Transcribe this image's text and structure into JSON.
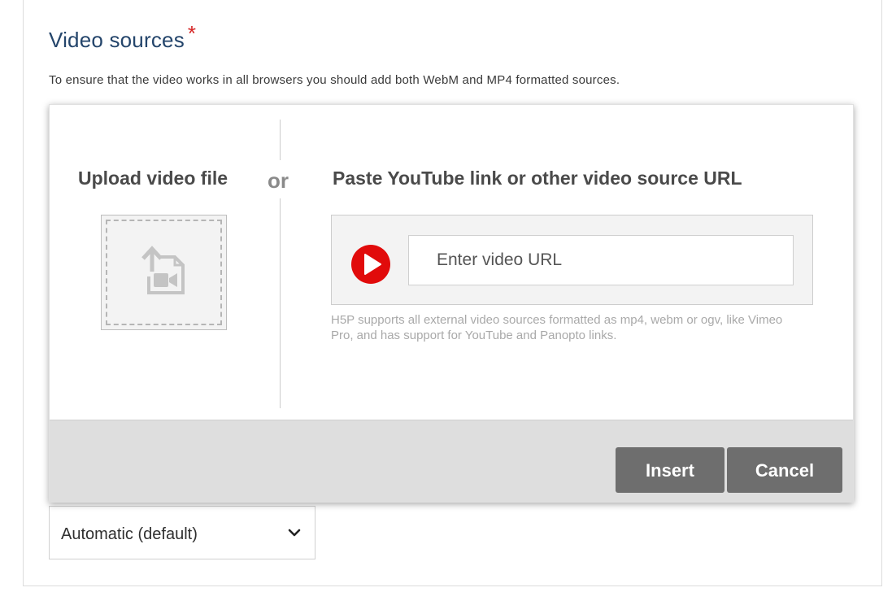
{
  "section": {
    "title": "Video sources",
    "required_marker": "*",
    "description": "To ensure that the video works in all browsers you should add both WebM and MP4 formatted sources."
  },
  "dialog": {
    "upload_heading": "Upload video file",
    "upload_icon": "video-file-upload-icon",
    "separator_text": "or",
    "url_heading": "Paste YouTube link or other video source URL",
    "url_input": {
      "value": "",
      "placeholder": "Enter video URL"
    },
    "url_icon": "youtube-play-icon",
    "help_text": "H5P supports all external video sources formatted as mp4, webm or ogv, like Vimeo Pro, and has support for YouTube and Panopto links.",
    "insert_label": "Insert",
    "cancel_label": "Cancel"
  },
  "quality_select": {
    "selected": "Automatic (default)",
    "chevron_icon": "chevron-down-icon"
  },
  "colors": {
    "title": "#24456b",
    "required": "#d52424",
    "button": "#6e6e6e",
    "youtube_red": "#e10b0b"
  }
}
